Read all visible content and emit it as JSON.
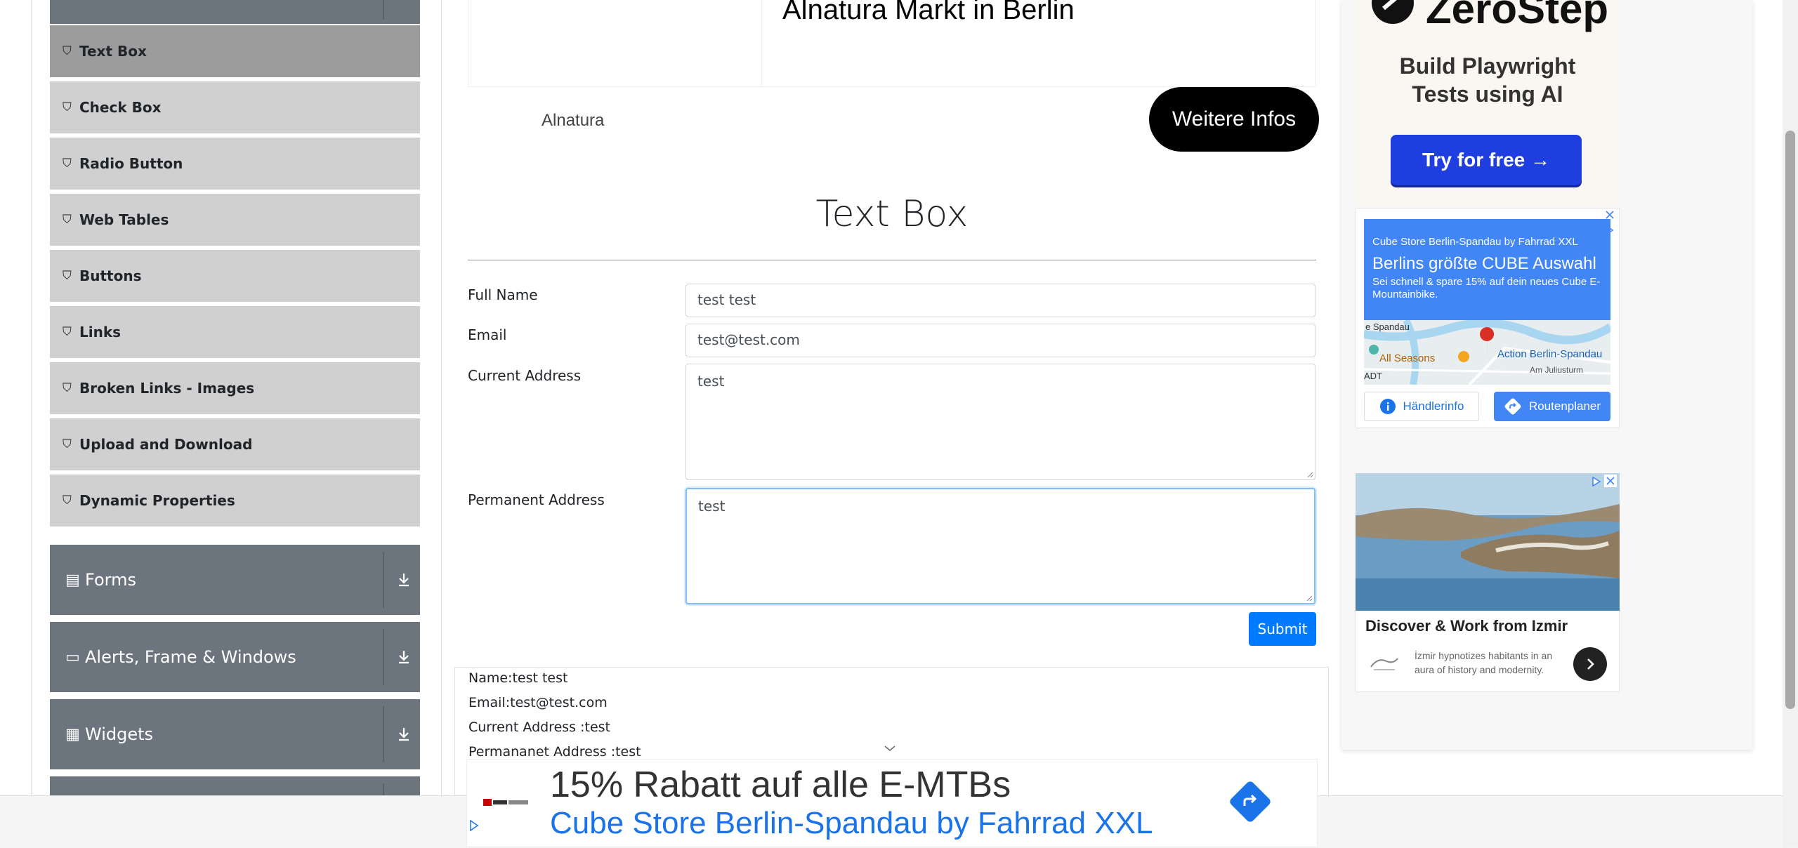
{
  "sidebar": {
    "elements_items": [
      {
        "label": "Text Box",
        "active": true
      },
      {
        "label": "Check Box",
        "active": false
      },
      {
        "label": "Radio Button",
        "active": false
      },
      {
        "label": "Web Tables",
        "active": false
      },
      {
        "label": "Buttons",
        "active": false
      },
      {
        "label": "Links",
        "active": false
      },
      {
        "label": "Broken Links - Images",
        "active": false
      },
      {
        "label": "Upload and Download",
        "active": false
      },
      {
        "label": "Dynamic Properties",
        "active": false
      }
    ],
    "groups": [
      {
        "label": "Forms",
        "icon": "form-icon"
      },
      {
        "label": "Alerts, Frame & Windows",
        "icon": "window-icon"
      },
      {
        "label": "Widgets",
        "icon": "widgets-icon"
      }
    ]
  },
  "top_ad": {
    "title": "Alnatura Markt in Berlin",
    "brand": "Alnatura",
    "cta": "Weitere Infos"
  },
  "main": {
    "header": "Text Box",
    "form": {
      "full_name_label": "Full Name",
      "full_name_value": "test test",
      "email_label": "Email",
      "email_value": "test@test.com",
      "current_address_label": "Current Address",
      "current_address_value": "test",
      "permanent_address_label": "Permanent Address",
      "permanent_address_value": "test",
      "submit_label": "Submit"
    },
    "output": {
      "name": "Name:test test",
      "email": "Email:test@test.com",
      "current_address": "Current Address :test",
      "permanent_address": "Permananet Address :test"
    }
  },
  "bottom_ad": {
    "headline": "15% Rabatt auf alle E-MTBs",
    "advertiser": "Cube Store Berlin-Spandau by Fahrrad XXL"
  },
  "right_ads": {
    "zerostep": {
      "brand": "ZeroStep",
      "tagline_line1": "Build Playwright",
      "tagline_line2": "Tests using AI",
      "cta": "Try for free →"
    },
    "cube": {
      "store": "Cube Store Berlin-Spandau by Fahrrad XXL",
      "title": "Berlins größte CUBE Auswahl",
      "desc": "Sei schnell & spare 15% auf dein neues Cube E-Mountainbike.",
      "map_label_1": "e Spandau",
      "map_label_2": "All Seasons",
      "map_label_3": "Action Berlin-Spandau",
      "map_label_4": "Am Juliusturm",
      "map_label_5": "ADT",
      "button_1": "Händlerinfo",
      "button_2": "Routenplaner"
    },
    "izmir": {
      "title": "Discover & Work from Izmir",
      "desc": "İzmir hypnotizes habitants in an aura of history and modernity."
    }
  },
  "colors": {
    "primary": "#007bff",
    "sidebar_group": "#6c757d",
    "sidebar_item": "#d0d0d0",
    "sidebar_active": "#9c9c9c",
    "zerostep_button": "#1f3ee0",
    "google_blue": "#4285f4"
  }
}
